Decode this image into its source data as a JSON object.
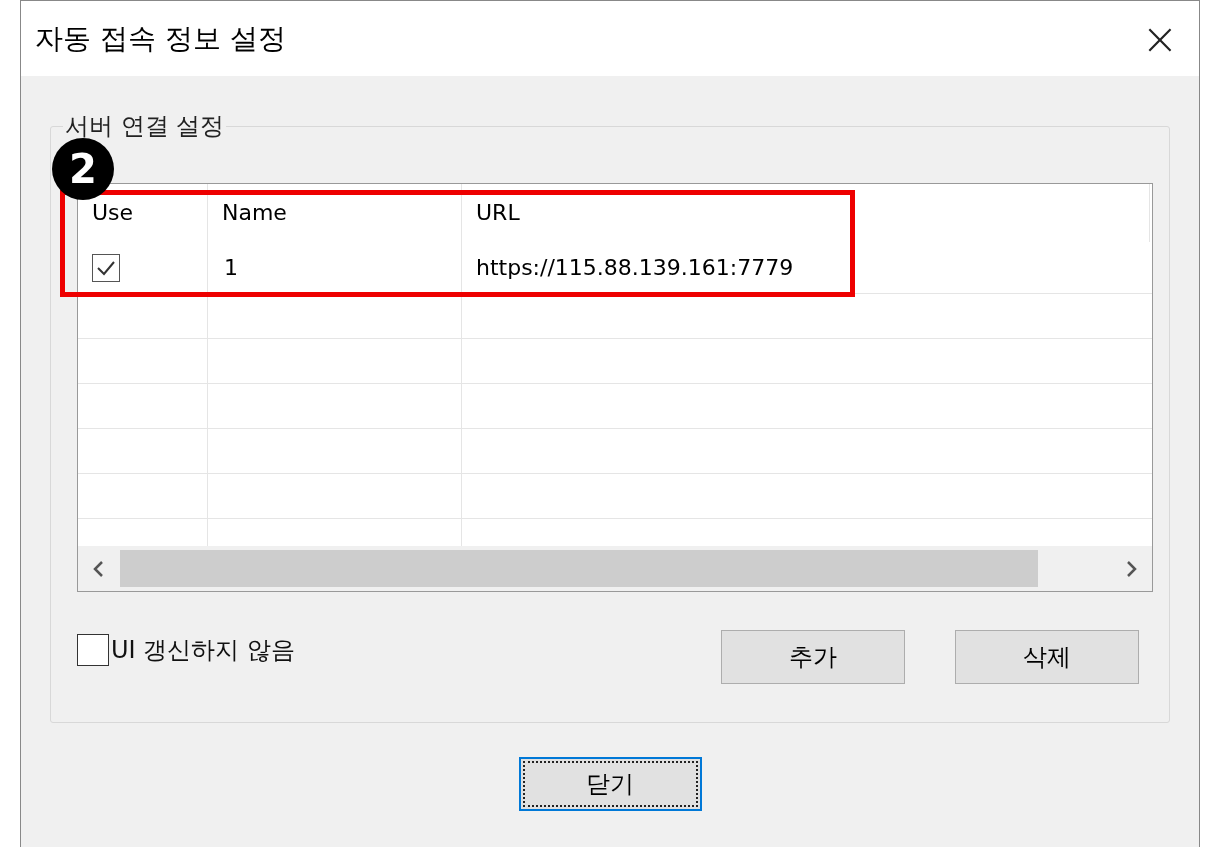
{
  "window": {
    "title": "자동 접속 정보 설정",
    "close_glyph": "×"
  },
  "group": {
    "title": "서버 연결 설정"
  },
  "table": {
    "columns": [
      "Use",
      "Name",
      "URL"
    ],
    "rows": [
      {
        "checked": true,
        "name": "1",
        "url": "https://115.88.139.161:7779"
      }
    ]
  },
  "option": {
    "label": "UI 갱신하지 않음",
    "checked": false
  },
  "buttons": [
    "추가",
    "삭제"
  ],
  "close_button": {
    "label": "닫기",
    "focused": true
  },
  "annotation": {
    "badge": "2"
  }
}
